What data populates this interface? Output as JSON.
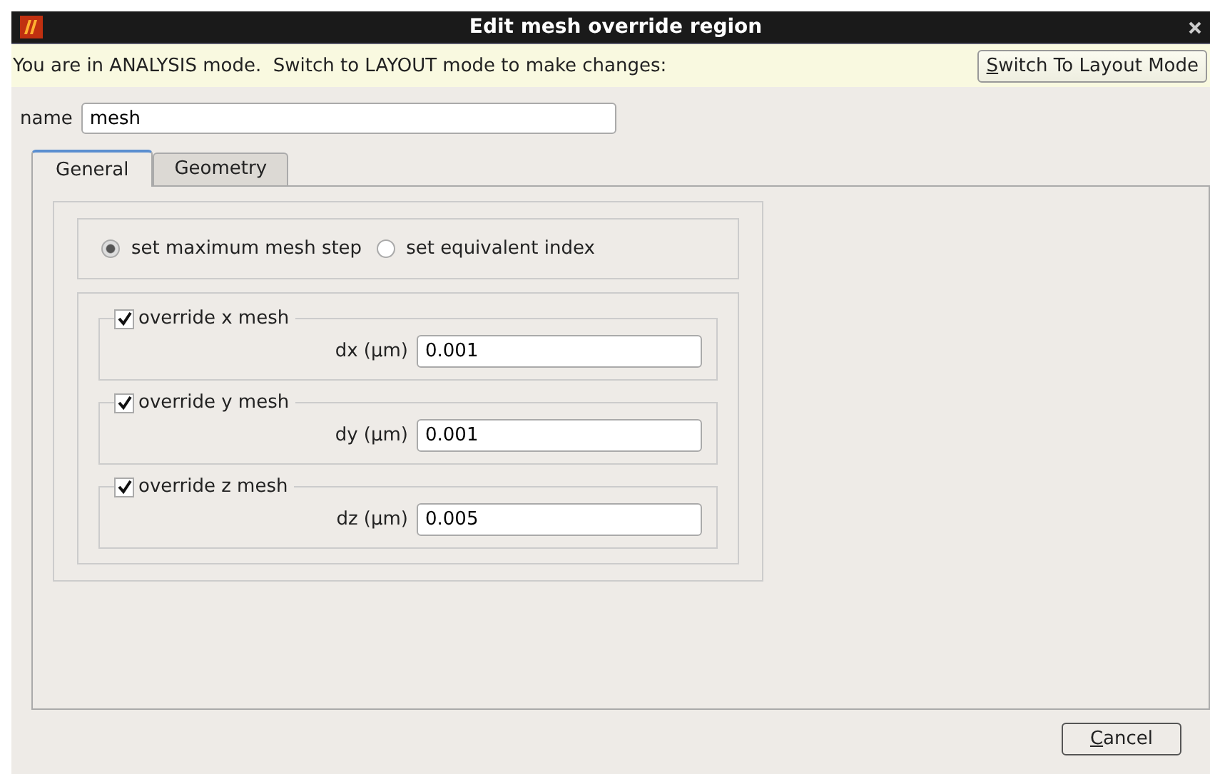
{
  "window": {
    "title": "Edit mesh override region"
  },
  "info_bar": {
    "message": "You are in ANALYSIS mode.  Switch to LAYOUT mode to make changes:",
    "button": "Switch To Layout Mode"
  },
  "name_field": {
    "label": "name",
    "value": "mesh"
  },
  "tabs": [
    {
      "label": "General",
      "selected": true
    },
    {
      "label": "Geometry",
      "selected": false
    }
  ],
  "mesh_mode": [
    {
      "label": "set maximum mesh step",
      "selected": true
    },
    {
      "label": "set equivalent index",
      "selected": false
    }
  ],
  "overrides": [
    {
      "label": "override x mesh",
      "checked": true,
      "field_label": "dx (µm)",
      "value": "0.001"
    },
    {
      "label": "override y mesh",
      "checked": true,
      "field_label": "dy (µm)",
      "value": "0.001"
    },
    {
      "label": "override z mesh",
      "checked": true,
      "field_label": "dz (µm)",
      "value": "0.005"
    }
  ],
  "buttons": [
    "Cancel"
  ]
}
